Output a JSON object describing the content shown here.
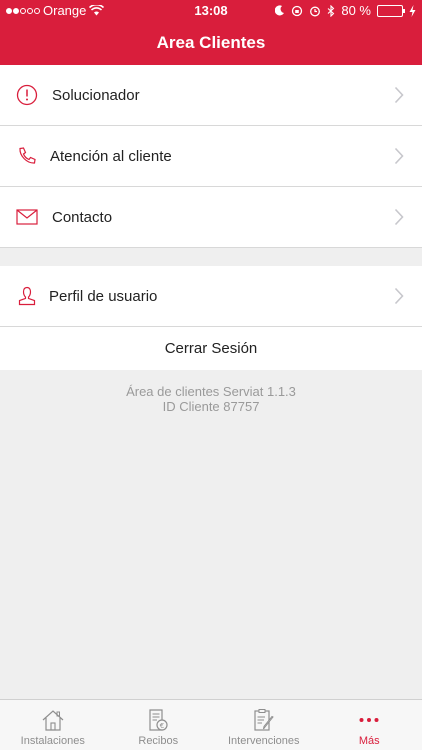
{
  "status_bar": {
    "carrier": "Orange",
    "time": "13:08",
    "battery": "80 %"
  },
  "header": {
    "title": "Area Clientes"
  },
  "menu": {
    "items": [
      {
        "label": "Solucionador",
        "icon": "alert-circle-icon"
      },
      {
        "label": "Atención al cliente",
        "icon": "phone-icon"
      },
      {
        "label": "Contacto",
        "icon": "mail-icon"
      }
    ]
  },
  "account": {
    "profile_label": "Perfil de usuario",
    "logout_label": "Cerrar Sesión"
  },
  "footer_info": {
    "version": "Área de clientes Serviat 1.1.3",
    "client_id": "ID Cliente 87757"
  },
  "tabbar": {
    "tabs": [
      {
        "label": "Instalaciones",
        "icon": "house-icon"
      },
      {
        "label": "Recibos",
        "icon": "receipt-euro-icon"
      },
      {
        "label": "Intervenciones",
        "icon": "clipboard-edit-icon"
      },
      {
        "label": "Más",
        "icon": "more-dots-icon"
      }
    ],
    "active_index": 3
  },
  "colors": {
    "brand": "#d91e3c",
    "background": "#efefef"
  }
}
